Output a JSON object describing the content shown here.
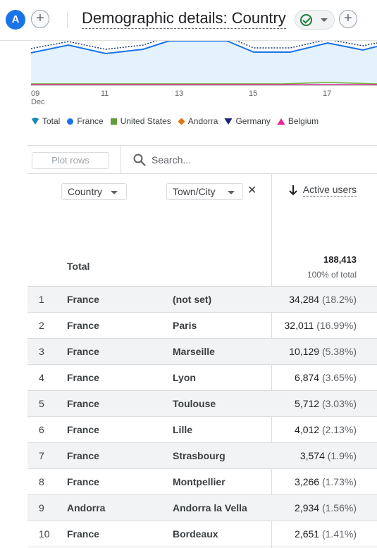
{
  "header": {
    "avatar_letter": "A",
    "add_comparison": "+",
    "title": "Demographic details: Country",
    "add_card": "+"
  },
  "chart_data": {
    "type": "area",
    "x_ticks": [
      {
        "label": "09",
        "sub": "Dec"
      },
      {
        "label": "11",
        "sub": ""
      },
      {
        "label": "13",
        "sub": ""
      },
      {
        "label": "15",
        "sub": ""
      },
      {
        "label": "17",
        "sub": ""
      }
    ],
    "legend": [
      {
        "name": "Total",
        "color": "#1e88b4",
        "marker": "drop"
      },
      {
        "name": "France",
        "color": "#1a73e8",
        "marker": "circle"
      },
      {
        "name": "United States",
        "color": "#5f9e3b",
        "marker": "square"
      },
      {
        "name": "Andorra",
        "color": "#e8710a",
        "marker": "diamond"
      },
      {
        "name": "Germany",
        "color": "#1a237e",
        "marker": "triangle"
      },
      {
        "name": "Belgium",
        "color": "#e52592",
        "marker": "triangle-up"
      }
    ]
  },
  "toolbar": {
    "plot_rows": "Plot rows",
    "search_placeholder": "Search..."
  },
  "table": {
    "dim1": "Country",
    "dim2": "Town/City",
    "remove": "✕",
    "metric": "Active users",
    "total_label": "Total",
    "total_value": "188,413",
    "total_pct": "100% of total",
    "rows": [
      {
        "rank": "1",
        "country": "France",
        "city": "(not set)",
        "value": "34,284",
        "pct": "(18.2%)"
      },
      {
        "rank": "2",
        "country": "France",
        "city": "Paris",
        "value": "32,011",
        "pct": "(16.99%)"
      },
      {
        "rank": "3",
        "country": "France",
        "city": "Marseille",
        "value": "10,129",
        "pct": "(5.38%)"
      },
      {
        "rank": "4",
        "country": "France",
        "city": "Lyon",
        "value": "6,874",
        "pct": "(3.65%)"
      },
      {
        "rank": "5",
        "country": "France",
        "city": "Toulouse",
        "value": "5,712",
        "pct": "(3.03%)"
      },
      {
        "rank": "6",
        "country": "France",
        "city": "Lille",
        "value": "4,012",
        "pct": "(2.13%)"
      },
      {
        "rank": "7",
        "country": "France",
        "city": "Strasbourg",
        "value": "3,574",
        "pct": "(1.9%)"
      },
      {
        "rank": "8",
        "country": "France",
        "city": "Montpellier",
        "value": "3,266",
        "pct": "(1.73%)"
      },
      {
        "rank": "9",
        "country": "Andorra",
        "city": "Andorra la Vella",
        "value": "2,934",
        "pct": "(1.56%)"
      },
      {
        "rank": "10",
        "country": "France",
        "city": "Bordeaux",
        "value": "2,651",
        "pct": "(1.41%)"
      }
    ]
  }
}
